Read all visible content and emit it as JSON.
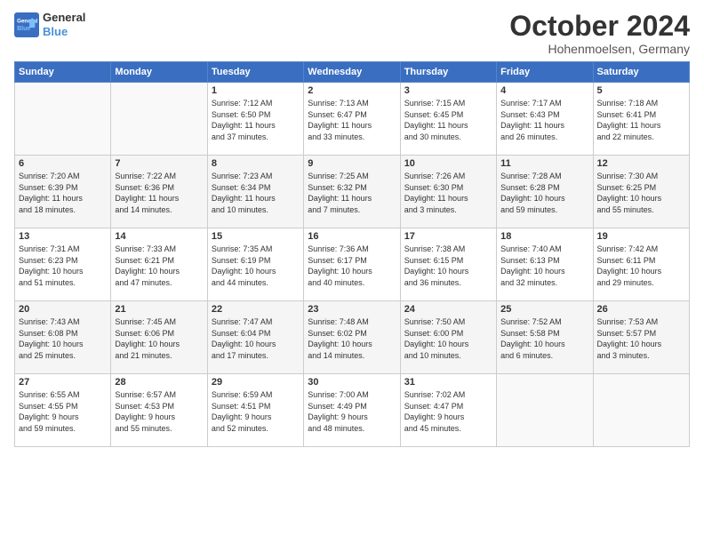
{
  "logo": {
    "line1": "General",
    "line2": "Blue"
  },
  "title": "October 2024",
  "location": "Hohenmoelsen, Germany",
  "days_header": [
    "Sunday",
    "Monday",
    "Tuesday",
    "Wednesday",
    "Thursday",
    "Friday",
    "Saturday"
  ],
  "weeks": [
    [
      {
        "day": "",
        "content": ""
      },
      {
        "day": "",
        "content": ""
      },
      {
        "day": "1",
        "content": "Sunrise: 7:12 AM\nSunset: 6:50 PM\nDaylight: 11 hours\nand 37 minutes."
      },
      {
        "day": "2",
        "content": "Sunrise: 7:13 AM\nSunset: 6:47 PM\nDaylight: 11 hours\nand 33 minutes."
      },
      {
        "day": "3",
        "content": "Sunrise: 7:15 AM\nSunset: 6:45 PM\nDaylight: 11 hours\nand 30 minutes."
      },
      {
        "day": "4",
        "content": "Sunrise: 7:17 AM\nSunset: 6:43 PM\nDaylight: 11 hours\nand 26 minutes."
      },
      {
        "day": "5",
        "content": "Sunrise: 7:18 AM\nSunset: 6:41 PM\nDaylight: 11 hours\nand 22 minutes."
      }
    ],
    [
      {
        "day": "6",
        "content": "Sunrise: 7:20 AM\nSunset: 6:39 PM\nDaylight: 11 hours\nand 18 minutes."
      },
      {
        "day": "7",
        "content": "Sunrise: 7:22 AM\nSunset: 6:36 PM\nDaylight: 11 hours\nand 14 minutes."
      },
      {
        "day": "8",
        "content": "Sunrise: 7:23 AM\nSunset: 6:34 PM\nDaylight: 11 hours\nand 10 minutes."
      },
      {
        "day": "9",
        "content": "Sunrise: 7:25 AM\nSunset: 6:32 PM\nDaylight: 11 hours\nand 7 minutes."
      },
      {
        "day": "10",
        "content": "Sunrise: 7:26 AM\nSunset: 6:30 PM\nDaylight: 11 hours\nand 3 minutes."
      },
      {
        "day": "11",
        "content": "Sunrise: 7:28 AM\nSunset: 6:28 PM\nDaylight: 10 hours\nand 59 minutes."
      },
      {
        "day": "12",
        "content": "Sunrise: 7:30 AM\nSunset: 6:25 PM\nDaylight: 10 hours\nand 55 minutes."
      }
    ],
    [
      {
        "day": "13",
        "content": "Sunrise: 7:31 AM\nSunset: 6:23 PM\nDaylight: 10 hours\nand 51 minutes."
      },
      {
        "day": "14",
        "content": "Sunrise: 7:33 AM\nSunset: 6:21 PM\nDaylight: 10 hours\nand 47 minutes."
      },
      {
        "day": "15",
        "content": "Sunrise: 7:35 AM\nSunset: 6:19 PM\nDaylight: 10 hours\nand 44 minutes."
      },
      {
        "day": "16",
        "content": "Sunrise: 7:36 AM\nSunset: 6:17 PM\nDaylight: 10 hours\nand 40 minutes."
      },
      {
        "day": "17",
        "content": "Sunrise: 7:38 AM\nSunset: 6:15 PM\nDaylight: 10 hours\nand 36 minutes."
      },
      {
        "day": "18",
        "content": "Sunrise: 7:40 AM\nSunset: 6:13 PM\nDaylight: 10 hours\nand 32 minutes."
      },
      {
        "day": "19",
        "content": "Sunrise: 7:42 AM\nSunset: 6:11 PM\nDaylight: 10 hours\nand 29 minutes."
      }
    ],
    [
      {
        "day": "20",
        "content": "Sunrise: 7:43 AM\nSunset: 6:08 PM\nDaylight: 10 hours\nand 25 minutes."
      },
      {
        "day": "21",
        "content": "Sunrise: 7:45 AM\nSunset: 6:06 PM\nDaylight: 10 hours\nand 21 minutes."
      },
      {
        "day": "22",
        "content": "Sunrise: 7:47 AM\nSunset: 6:04 PM\nDaylight: 10 hours\nand 17 minutes."
      },
      {
        "day": "23",
        "content": "Sunrise: 7:48 AM\nSunset: 6:02 PM\nDaylight: 10 hours\nand 14 minutes."
      },
      {
        "day": "24",
        "content": "Sunrise: 7:50 AM\nSunset: 6:00 PM\nDaylight: 10 hours\nand 10 minutes."
      },
      {
        "day": "25",
        "content": "Sunrise: 7:52 AM\nSunset: 5:58 PM\nDaylight: 10 hours\nand 6 minutes."
      },
      {
        "day": "26",
        "content": "Sunrise: 7:53 AM\nSunset: 5:57 PM\nDaylight: 10 hours\nand 3 minutes."
      }
    ],
    [
      {
        "day": "27",
        "content": "Sunrise: 6:55 AM\nSunset: 4:55 PM\nDaylight: 9 hours\nand 59 minutes."
      },
      {
        "day": "28",
        "content": "Sunrise: 6:57 AM\nSunset: 4:53 PM\nDaylight: 9 hours\nand 55 minutes."
      },
      {
        "day": "29",
        "content": "Sunrise: 6:59 AM\nSunset: 4:51 PM\nDaylight: 9 hours\nand 52 minutes."
      },
      {
        "day": "30",
        "content": "Sunrise: 7:00 AM\nSunset: 4:49 PM\nDaylight: 9 hours\nand 48 minutes."
      },
      {
        "day": "31",
        "content": "Sunrise: 7:02 AM\nSunset: 4:47 PM\nDaylight: 9 hours\nand 45 minutes."
      },
      {
        "day": "",
        "content": ""
      },
      {
        "day": "",
        "content": ""
      }
    ]
  ]
}
